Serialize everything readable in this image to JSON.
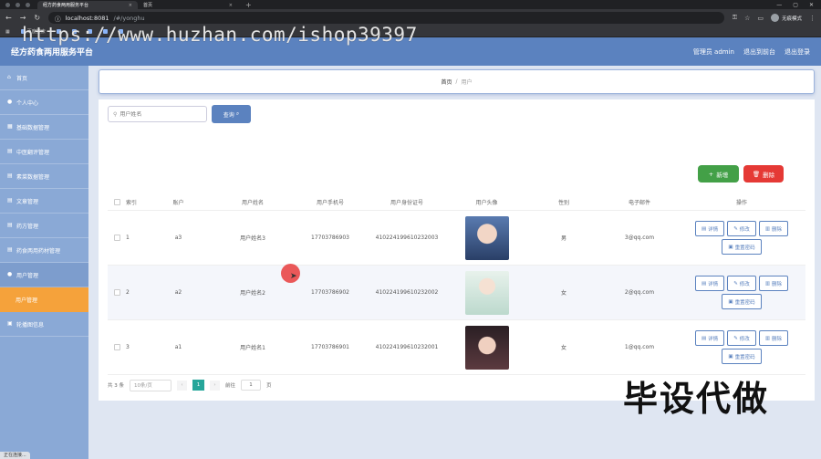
{
  "browser": {
    "tabs": [
      {
        "title": "经方药食两用服务平台",
        "active": true
      },
      {
        "title": "首页",
        "active": false
      }
    ],
    "url_host": "localhost:8081",
    "url_path": "/#/yonghu",
    "profile_label": "无痕模式",
    "bookmarks": [
      "百度搜索",
      "",
      "",
      "",
      "",
      "",
      "",
      ""
    ]
  },
  "watermark": "https://www.huzhan.com/ishop39397",
  "app": {
    "title": "经方药食两用服务平台",
    "header_links": [
      "管理员 admin",
      "退出到前台",
      "退出登录"
    ]
  },
  "sidebar": {
    "items": [
      {
        "label": "首页",
        "icon": "home-icon"
      },
      {
        "label": "个人中心",
        "icon": "user-icon"
      },
      {
        "label": "基础数据管理",
        "icon": "grid-icon"
      },
      {
        "label": "中医翻评管理",
        "icon": "doc-icon"
      },
      {
        "label": "素菜数据管理",
        "icon": "doc-icon"
      },
      {
        "label": "文章管理",
        "icon": "doc-icon"
      },
      {
        "label": "药方管理",
        "icon": "doc-icon"
      },
      {
        "label": "药食两用药材管理",
        "icon": "doc-icon"
      },
      {
        "label": "用户管理",
        "icon": "users-icon"
      },
      {
        "label": "用户管理",
        "icon": "",
        "sub": true
      },
      {
        "label": "轮播图信息",
        "icon": "image-icon"
      }
    ]
  },
  "breadcrumb": {
    "home": "首页",
    "sep": "/",
    "current": "用户"
  },
  "search": {
    "placeholder": "用户姓名",
    "button": "查询"
  },
  "actions": {
    "add": "新增",
    "delete": "删除"
  },
  "table": {
    "headers": {
      "index": "索引",
      "account": "账户",
      "name": "用户姓名",
      "phone": "用户手机号",
      "idcard": "用户身份证号",
      "avatar": "用户头像",
      "sex": "性别",
      "email": "电子邮件",
      "ops": "操作"
    },
    "rows": [
      {
        "index": "1",
        "account": "a3",
        "name": "用户姓名3",
        "phone": "17703786903",
        "idcard": "410224199610232003",
        "sex": "男",
        "email": "3@qq.com"
      },
      {
        "index": "2",
        "account": "a2",
        "name": "用户姓名2",
        "phone": "17703786902",
        "idcard": "410224199610232002",
        "sex": "女",
        "email": "2@qq.com"
      },
      {
        "index": "3",
        "account": "a1",
        "name": "用户姓名1",
        "phone": "17703786901",
        "idcard": "410224199610232001",
        "sex": "女",
        "email": "1@qq.com"
      }
    ],
    "op_labels": {
      "detail": "详情",
      "edit": "修改",
      "delete": "删除",
      "reset": "重置密码"
    }
  },
  "pagination": {
    "total": "共 3 条",
    "page_size": "10条/页",
    "current_page": "1",
    "goto_label": "前往",
    "goto_value": "1",
    "page_suffix": "页"
  },
  "overlay_text": "毕设代做",
  "status": "正在连接..."
}
